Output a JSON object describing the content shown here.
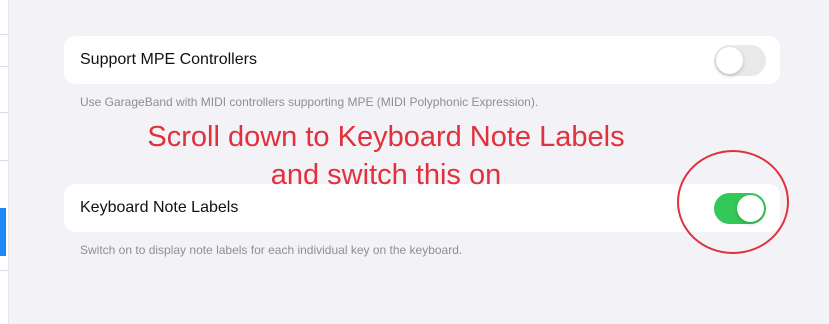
{
  "settings": {
    "mpe": {
      "label": "Support MPE Controllers",
      "footer": "Use GarageBand with MIDI controllers supporting MPE (MIDI Polyphonic Expression).",
      "toggle_on": false
    },
    "note_labels": {
      "label": "Keyboard Note Labels",
      "footer": "Switch on to display note labels for each individual key on the keyboard.",
      "toggle_on": true
    }
  },
  "annotation": {
    "line1": "Scroll down to Keyboard Note Labels",
    "line2": "and switch this on",
    "color": "#e0313c"
  },
  "colors": {
    "toggle_on": "#34c759",
    "toggle_off": "#e9e9eb",
    "sidebar_selected": "#1e88f5"
  }
}
